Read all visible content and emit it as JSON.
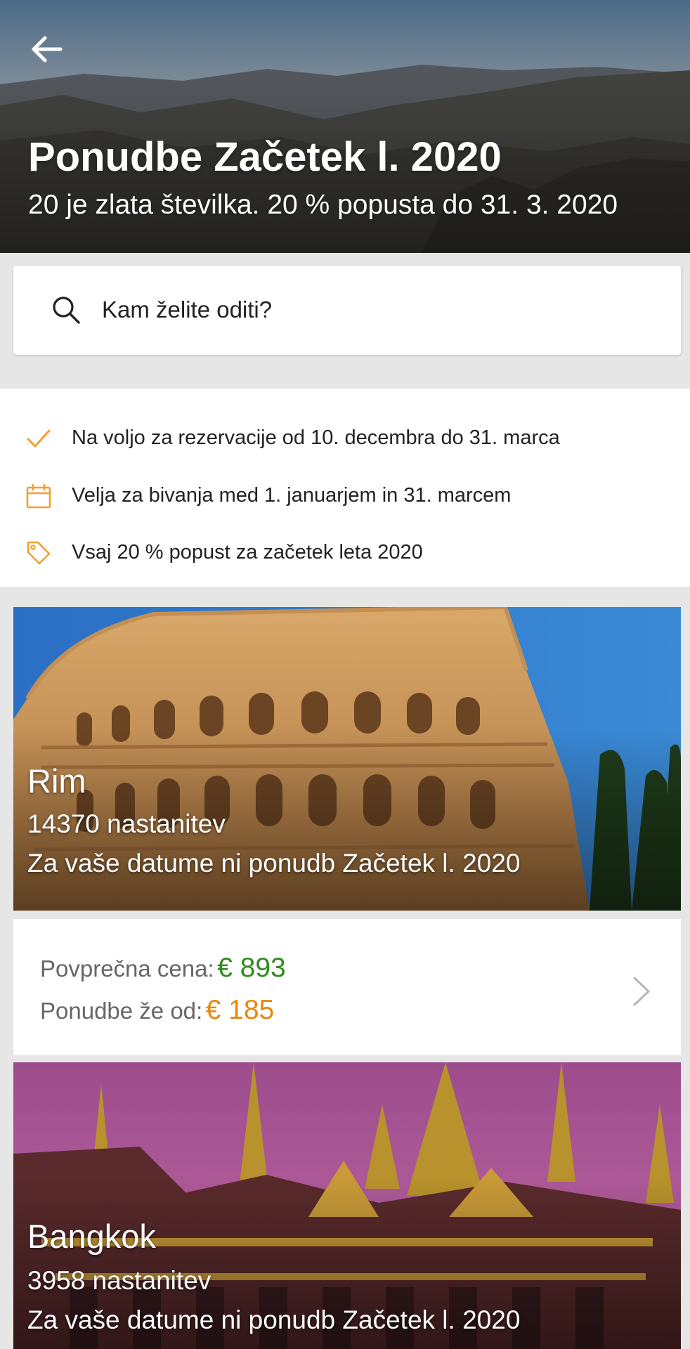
{
  "hero": {
    "title": "Ponudbe Začetek l. 2020",
    "subtitle": "20 je zlata številka. 20 % popusta do 31. 3. 2020",
    "back_icon": "arrow-left-icon"
  },
  "search": {
    "placeholder": "Kam želite oditi?",
    "icon": "search-icon"
  },
  "info": {
    "items": [
      {
        "icon": "checkmark-icon",
        "label": "Na voljo za rezervacije od 10. decembra do 31. marca"
      },
      {
        "icon": "calendar-icon",
        "label": "Velja za bivanja med 1. januarjem in 31. marcem"
      },
      {
        "icon": "tag-icon",
        "label": "Vsaj 20 % popust za začetek leta 2020"
      }
    ],
    "accent_color": "#f0a030"
  },
  "destinations": [
    {
      "name": "Rim",
      "count": "14370 nastanitev",
      "note": "Za vaše datume ni ponudb Začetek l. 2020",
      "avg_price_label": "Povprečna cena:",
      "avg_price": "€ 893",
      "from_price_label": "Ponudbe že od:",
      "from_price": "€ 185"
    },
    {
      "name": "Bangkok",
      "count": "3958 nastanitev",
      "note": "Za vaše datume ni ponudb Začetek l. 2020"
    }
  ],
  "colors": {
    "avg_price": "#2e8b1e",
    "from_price": "#e8870e",
    "chevron": "#b5b5b5"
  }
}
